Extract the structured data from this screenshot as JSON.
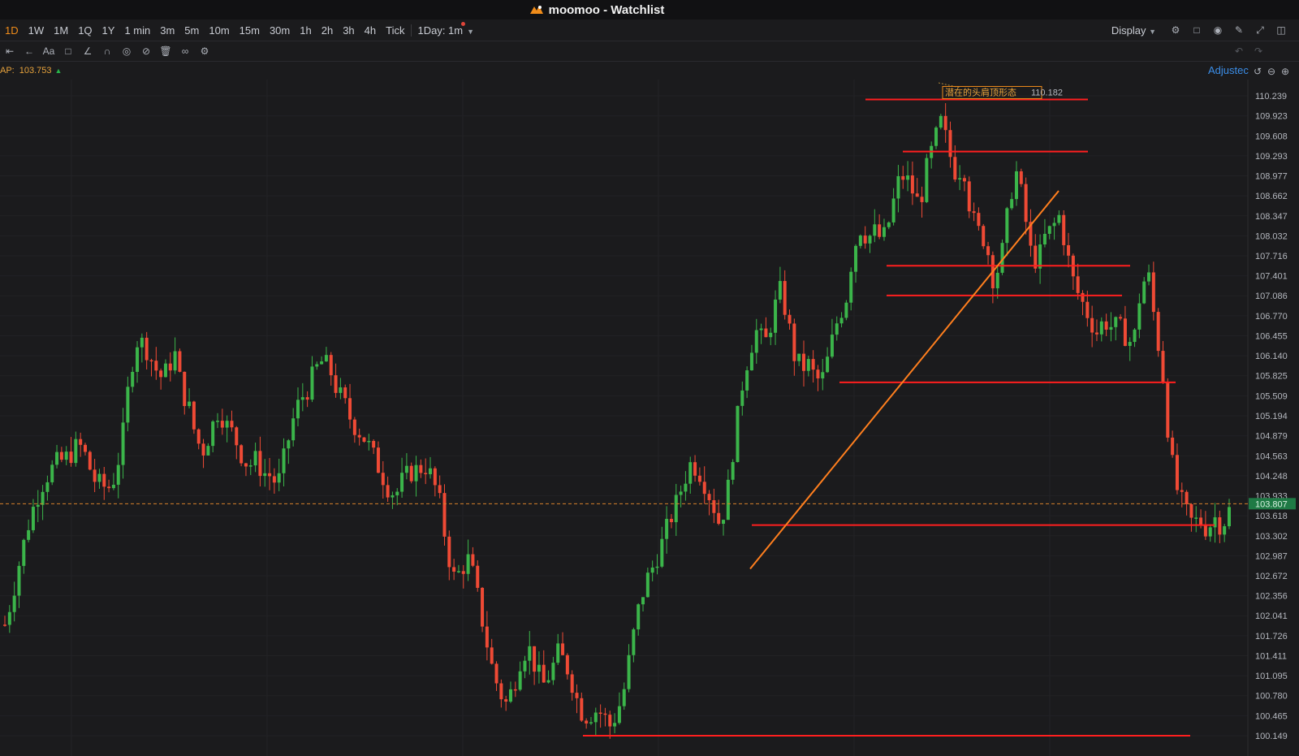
{
  "window": {
    "title": "moomoo - Watchlist"
  },
  "timeframes": [
    {
      "label": "1D",
      "active": true
    },
    {
      "label": "1W"
    },
    {
      "label": "1M"
    },
    {
      "label": "1Q"
    },
    {
      "label": "1Y"
    },
    {
      "label": "1 min"
    },
    {
      "label": "3m"
    },
    {
      "label": "5m"
    },
    {
      "label": "10m"
    },
    {
      "label": "15m"
    },
    {
      "label": "30m"
    },
    {
      "label": "1h"
    },
    {
      "label": "2h"
    },
    {
      "label": "3h"
    },
    {
      "label": "4h"
    },
    {
      "label": "Tick"
    },
    {
      "label": "1Day: 1m"
    }
  ],
  "toolbar_right": {
    "display_label": "Display"
  },
  "indicator": {
    "label": "AP:",
    "value": "103.753"
  },
  "adjust_label": "Adjustec",
  "colors": {
    "up": "#3bb54a",
    "down": "#ef4a35",
    "accent": "#f08c1a",
    "trend": "#ff7f1e",
    "level": "#ff1f1f",
    "price_tag": "#1f7a45"
  },
  "chart_data": {
    "type": "candlestick",
    "y_axis_ticks": [
      "110.239",
      "109.923",
      "109.608",
      "109.293",
      "108.977",
      "108.662",
      "108.347",
      "108.032",
      "107.716",
      "107.401",
      "107.086",
      "106.770",
      "106.455",
      "106.140",
      "105.825",
      "105.509",
      "105.194",
      "104.879",
      "104.563",
      "104.248",
      "103.933",
      "103.618",
      "103.302",
      "102.987",
      "102.672",
      "102.356",
      "102.041",
      "101.726",
      "101.411",
      "101.095",
      "100.780",
      "100.465",
      "100.149"
    ],
    "ylim": [
      100.149,
      110.239
    ],
    "current_price": "103.807",
    "annotation": {
      "text": "潜在的头肩顶形态",
      "value": "110.182"
    },
    "horizontal_levels": [
      110.182,
      109.36,
      107.56,
      107.09,
      105.72,
      103.47,
      100.149
    ],
    "close_path": [
      101.9,
      102.35,
      102.9,
      103.4,
      103.8,
      104.1,
      104.3,
      104.45,
      104.5,
      104.6,
      104.75,
      104.55,
      104.2,
      104.1,
      104.05,
      104.25,
      104.9,
      105.9,
      106.4,
      106.3,
      106.05,
      105.8,
      105.9,
      106.2,
      105.6,
      105.3,
      104.8,
      104.65,
      105.0,
      105.3,
      105.05,
      104.9,
      104.6,
      104.4,
      104.5,
      104.3,
      104.25,
      104.1,
      104.6,
      105.1,
      105.45,
      105.6,
      105.9,
      106.05,
      105.95,
      105.6,
      105.4,
      105.1,
      104.95,
      104.8,
      104.55,
      104.3,
      104.05,
      103.95,
      104.2,
      104.3,
      104.35,
      104.4,
      104.2,
      103.8,
      103.05,
      102.6,
      102.8,
      102.95,
      102.4,
      101.8,
      101.25,
      100.85,
      100.65,
      100.95,
      101.4,
      101.55,
      101.2,
      100.95,
      101.15,
      101.45,
      101.3,
      100.95,
      100.55,
      100.45,
      100.55,
      100.5,
      100.3,
      100.5,
      100.9,
      101.6,
      102.2,
      102.6,
      102.85,
      103.15,
      103.5,
      103.8,
      104.15,
      104.45,
      104.35,
      104.1,
      103.8,
      103.45,
      104.0,
      104.9,
      105.7,
      106.25,
      106.55,
      106.3,
      106.7,
      107.2,
      106.8,
      106.15,
      105.95,
      106.0,
      105.75,
      105.8,
      106.3,
      106.75,
      107.0,
      107.8,
      108.15,
      108.0,
      108.1,
      107.95,
      108.3,
      108.85,
      109.0,
      108.75,
      108.5,
      109.1,
      109.5,
      109.85,
      109.35,
      109.0,
      109.15,
      108.35,
      108.1,
      107.95,
      107.35,
      107.6,
      108.4,
      109.1,
      108.6,
      107.8,
      107.6,
      108.0,
      108.15,
      108.35,
      107.75,
      107.25,
      107.0,
      106.75,
      106.5,
      106.7,
      106.6,
      106.6,
      106.45,
      106.3,
      107.2,
      107.45,
      106.6,
      105.85,
      104.6,
      104.0,
      103.7,
      103.5,
      103.55,
      103.4,
      103.6,
      103.45,
      103.7
    ]
  }
}
